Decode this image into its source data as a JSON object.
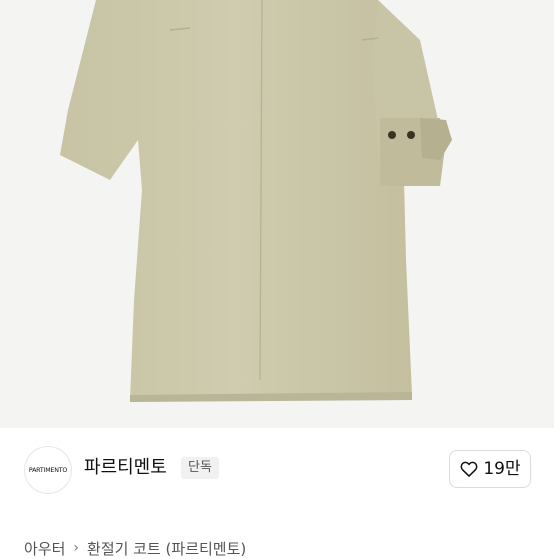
{
  "product_image": {
    "alt": "product photo",
    "color": "#c9c6a8"
  },
  "brand": {
    "logo_text": "PARTIMENTO",
    "name": "파르티멘토",
    "badge": "단독"
  },
  "like": {
    "icon": "heart-outline-icon",
    "count": "19만"
  },
  "breadcrumb": {
    "category": "아우터",
    "separator_icon": "chevron-right-icon",
    "subcategory": "환절기 코트 (파르티멘토)"
  }
}
